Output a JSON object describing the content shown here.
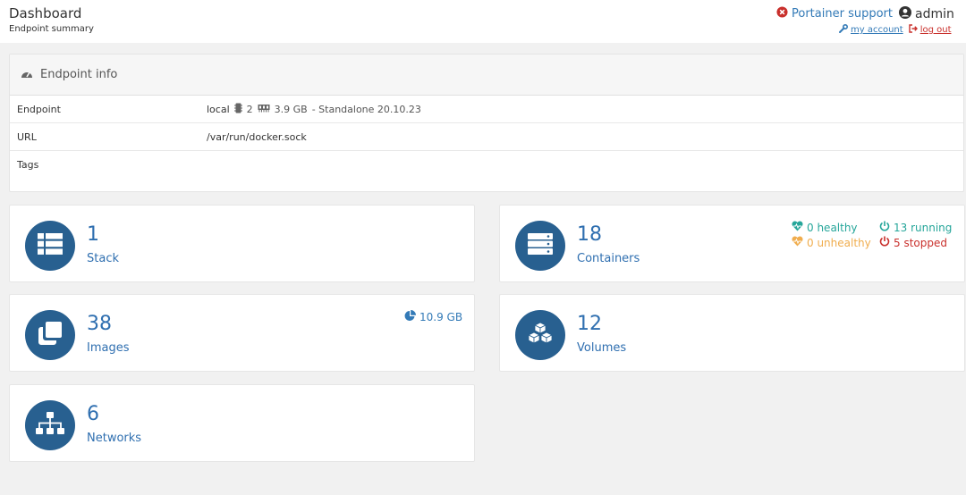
{
  "header": {
    "title": "Dashboard",
    "subtitle": "Endpoint summary",
    "support_label": "Portainer support",
    "user_name": "admin",
    "my_account_label": "my account",
    "logout_label": "log out"
  },
  "endpoint_info": {
    "heading": "Endpoint info",
    "rows": [
      {
        "key": "Endpoint",
        "name": "local",
        "cpu": "2",
        "memory": "3.9 GB",
        "mode": "- Standalone 20.10.23"
      },
      {
        "key": "URL",
        "value": "/var/run/docker.sock"
      },
      {
        "key": "Tags",
        "value": ""
      }
    ]
  },
  "stats": {
    "stack": {
      "count": "1",
      "label": "Stack"
    },
    "containers": {
      "count": "18",
      "label": "Containers",
      "healthy": "0 healthy",
      "unhealthy": "0 unhealthy",
      "running": "13 running",
      "stopped": "5 stopped"
    },
    "images": {
      "count": "38",
      "label": "Images",
      "size": "10.9 GB"
    },
    "volumes": {
      "count": "12",
      "label": "Volumes"
    },
    "networks": {
      "count": "6",
      "label": "Networks"
    }
  },
  "colors": {
    "accent": "#286090",
    "link": "#337ab7",
    "healthy": "#26a69a",
    "unhealthy": "#f0ad4e",
    "stopped": "#c9302c"
  }
}
